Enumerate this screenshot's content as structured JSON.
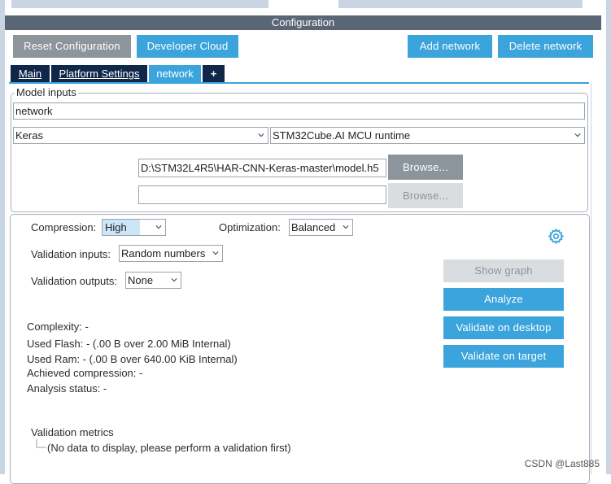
{
  "window": {
    "title": "Configuration"
  },
  "toolbar": {
    "reset_label": "Reset Configuration",
    "cloud_label": "Developer Cloud",
    "add_label": "Add network",
    "delete_label": "Delete network"
  },
  "tabs": [
    {
      "label": "Main"
    },
    {
      "label": "Platform Settings"
    },
    {
      "label": "network"
    },
    {
      "label": "+"
    }
  ],
  "model_inputs": {
    "legend": "Model inputs",
    "name_value": "network",
    "framework": "Keras",
    "runtime": "STM32Cube.AI MCU runtime",
    "model_path": "D:\\STM32L4R5\\HAR-CNN-Keras-master\\model.h5",
    "second_path": "",
    "browse_label": "Browse...",
    "browse2_label": "Browse..."
  },
  "settings": {
    "compression_label": "Compression:",
    "compression_value": "High",
    "optimization_label": "Optimization:",
    "optimization_value": "Balanced",
    "val_inputs_label": "Validation inputs:",
    "val_inputs_value": "Random numbers",
    "val_outputs_label": "Validation outputs:",
    "val_outputs_value": "None"
  },
  "actions": {
    "show_graph": "Show graph",
    "analyze": "Analyze",
    "validate_desktop": "Validate on desktop",
    "validate_target": "Validate on target"
  },
  "report": {
    "complexity": "Complexity: -",
    "used_flash": "Used Flash: - (.00 B over 2.00 MiB Internal)",
    "used_ram": "Used Ram: - (.00 B over 640.00 KiB Internal)",
    "achieved_compression": "Achieved compression: -",
    "analysis_status": "Analysis status: -"
  },
  "metrics": {
    "title": "Validation metrics",
    "empty_message": "(No data to display, please perform a validation first)"
  },
  "watermark": "CSDN @Last885",
  "colors": {
    "accent": "#3ba4dc",
    "tab_dark": "#0f2749",
    "title_bar": "#5a6675",
    "gear": "#3ba4dc"
  }
}
